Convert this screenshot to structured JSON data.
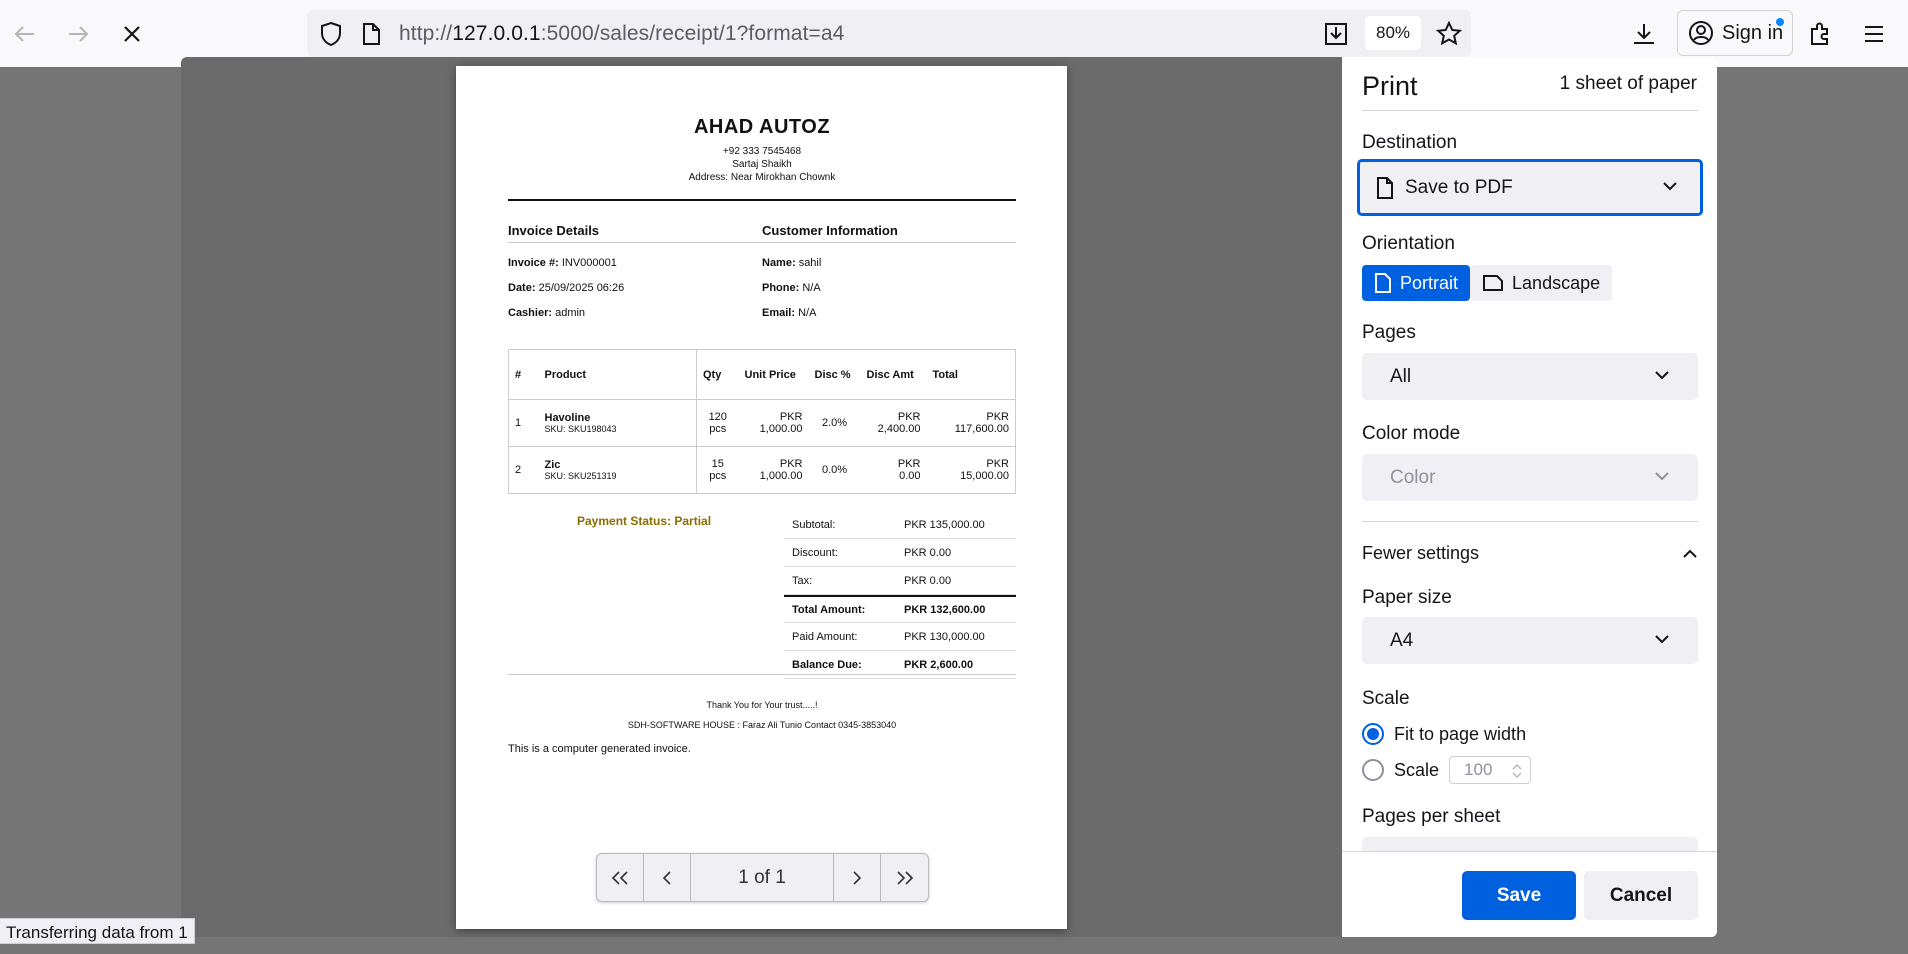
{
  "browser": {
    "url_prefix": "http://",
    "url_host": "127.0.0.1",
    "url_rest": ":5000/sales/receipt/1?format=a4",
    "zoom": "80%",
    "signin_label": "Sign in",
    "status_text": "Transferring data from 1"
  },
  "receipt": {
    "shop_name": "AHAD AUTOZ",
    "phone": "+92 333 7545468",
    "owner": "Sartaj Shaikh",
    "address": "Address: Near Mirokhan Chownk",
    "invoice_heading": "Invoice Details",
    "customer_heading": "Customer Information",
    "invoice_no_label": "Invoice #:",
    "invoice_no": "INV000001",
    "date_label": "Date:",
    "date": "25/09/2025 06:26",
    "cashier_label": "Cashier:",
    "cashier": "admin",
    "name_label": "Name:",
    "name": "sahil",
    "phone_label": "Phone:",
    "customer_phone": "N/A",
    "email_label": "Email:",
    "email": "N/A",
    "columns": [
      "#",
      "Product",
      "Qty",
      "Unit Price",
      "Disc %",
      "Disc Amt",
      "Total"
    ],
    "items": [
      {
        "n": "1",
        "product": "Havoline",
        "sku": "SKU: SKU198043",
        "qty": "120",
        "unit": "pcs",
        "price_cur": "PKR",
        "price": "1,000.00",
        "disc_pct": "2.0%",
        "disc_cur": "PKR",
        "disc_amt": "2,400.00",
        "total_cur": "PKR",
        "total": "117,600.00"
      },
      {
        "n": "2",
        "product": "Zic",
        "sku": "SKU: SKU251319",
        "qty": "15",
        "unit": "pcs",
        "price_cur": "PKR",
        "price": "1,000.00",
        "disc_pct": "0.0%",
        "disc_cur": "PKR",
        "disc_amt": "0.00",
        "total_cur": "PKR",
        "total": "15,000.00"
      }
    ],
    "payment_status": "Payment Status: Partial",
    "totals": [
      {
        "label": "Subtotal:",
        "value": "PKR 135,000.00"
      },
      {
        "label": "Discount:",
        "value": "PKR 0.00"
      },
      {
        "label": "Tax:",
        "value": "PKR 0.00"
      },
      {
        "label": "Total Amount:",
        "value": "PKR 132,600.00"
      },
      {
        "label": "Paid Amount:",
        "value": "PKR 130,000.00"
      },
      {
        "label": "Balance Due:",
        "value": "PKR 2,600.00"
      }
    ],
    "thanks": "Thank You for Your trust.....!",
    "credit": "SDH-SOFTWARE HOUSE : Faraz Ali Tunio Contact 0345-3853040",
    "note": "This is a computer generated invoice."
  },
  "page_nav": {
    "label": "1 of 1"
  },
  "print": {
    "title": "Print",
    "sheets": "1 sheet of paper",
    "destination_label": "Destination",
    "destination_value": "Save to PDF",
    "orientation_label": "Orientation",
    "portrait": "Portrait",
    "landscape": "Landscape",
    "pages_label": "Pages",
    "pages_value": "All",
    "color_label": "Color mode",
    "color_value": "Color",
    "fewer_settings": "Fewer settings",
    "paper_label": "Paper size",
    "paper_value": "A4",
    "scale_label": "Scale",
    "fit_label": "Fit to page width",
    "scale_option": "Scale",
    "scale_value": "100",
    "pps_label": "Pages per sheet",
    "save": "Save",
    "cancel": "Cancel"
  },
  "colors": {
    "accent": "#0061e0",
    "status": "#8a6d00"
  }
}
